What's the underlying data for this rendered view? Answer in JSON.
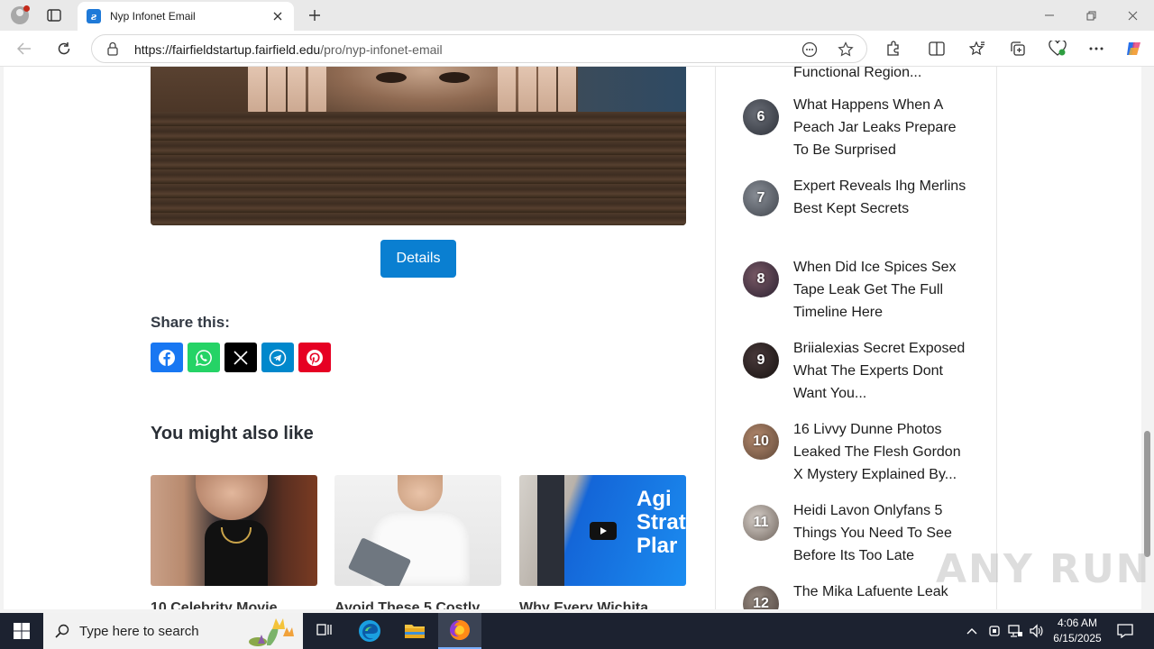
{
  "browser": {
    "tab_title": "Nyp Infonet Email",
    "url_host": "https://fairfieldstartup.fairfield.edu",
    "url_path": "/pro/nyp-infonet-email"
  },
  "page": {
    "details_label": "Details",
    "share_title": "Share this:",
    "related_title": "You might also like",
    "cards": [
      {
        "title": "10 Celebrity Movie"
      },
      {
        "title": "Avoid These 5 Costly"
      },
      {
        "title": "Why Every Wichita"
      }
    ],
    "card3_overlay": "Agi Strateg Plar"
  },
  "sidebar": {
    "top_fragment": "Functional Region...",
    "items": [
      {
        "rank": "6",
        "title": "What Happens When A Peach Jar Leaks Prepare To Be Surprised"
      },
      {
        "rank": "7",
        "title": "Expert Reveals Ihg Merlins Best Kept Secrets"
      },
      {
        "rank": "8",
        "title": "When Did Ice Spices Sex Tape Leak Get The Full Timeline Here"
      },
      {
        "rank": "9",
        "title": "Briialexias Secret Exposed What The Experts Dont Want You..."
      },
      {
        "rank": "10",
        "title": "16 Livvy Dunne Photos Leaked The Flesh Gordon X Mystery Explained By..."
      },
      {
        "rank": "11",
        "title": "Heidi Lavon Onlyfans 5 Things You Need To See Before Its Too Late"
      },
      {
        "rank": "12",
        "title": "The Mika Lafuente Leak"
      }
    ]
  },
  "watermark": "ANY RUN",
  "taskbar": {
    "search_placeholder": "Type here to search",
    "time": "4:06 AM",
    "date": "6/15/2025"
  },
  "colors": {
    "details_button": "#0a7fd1",
    "facebook": "#1877f2",
    "whatsapp": "#25d366",
    "x": "#000000",
    "telegram": "#0088cc",
    "pinterest": "#e60023"
  }
}
